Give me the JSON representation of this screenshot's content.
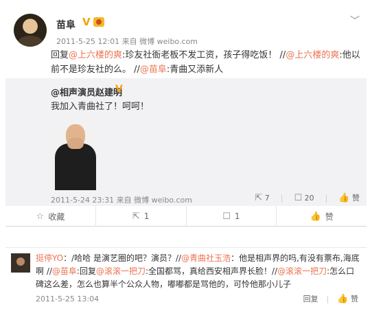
{
  "post": {
    "author": "苗阜",
    "verified_badge": "V",
    "time": "2011-5-25 12:01",
    "source": "来自 微博 weibo.com",
    "text_parts": [
      {
        "t": "回复",
        "link": false
      },
      {
        "t": "@上六楼的爽",
        "link": true
      },
      {
        "t": ":珍友社衙老板不发工资，孩子得吃饭！ //",
        "link": false
      },
      {
        "t": "@上六楼的爽",
        "link": true
      },
      {
        "t": ":他以前不是珍友社的么。 //",
        "link": false
      },
      {
        "t": "@苗阜",
        "link": true
      },
      {
        "t": ":青曲又添新人",
        "link": false
      }
    ],
    "quote": {
      "author": "@相声演员赵建明",
      "verified_badge": "V",
      "text": "我加入青曲社了！呵呵！",
      "time": "2011-5-24 23:31",
      "source": "来自 微博 weibo.com",
      "reposts": "7",
      "comments": "20",
      "like_label": "赞"
    },
    "actions": {
      "favorite": "收藏",
      "repost": "1",
      "comment": "1",
      "like": "赞"
    }
  },
  "comment": {
    "parts": [
      {
        "t": "挺停YO",
        "link": true
      },
      {
        "t": "：/哈哈 是演艺圈的吧？演员？//",
        "link": false
      },
      {
        "t": "@青曲社玉浩",
        "link": true
      },
      {
        "t": "：他是相声界的吗,有没有票布,海底啊 //",
        "link": false
      },
      {
        "t": "@苗阜",
        "link": true
      },
      {
        "t": ":回复",
        "link": false
      },
      {
        "t": "@滚滚一把刀",
        "link": true
      },
      {
        "t": ":全国都骂，真给西安相声界长脸！//",
        "link": false
      },
      {
        "t": "@滚滚一把刀",
        "link": true
      },
      {
        "t": ":怎么口碑这么差，怎么也算半个公众人物，嘟嘟都是骂他的，可怜他那小儿子",
        "link": false
      }
    ],
    "time": "2011-5-25 13:04",
    "reply_label": "回复",
    "like_label": "赞"
  }
}
